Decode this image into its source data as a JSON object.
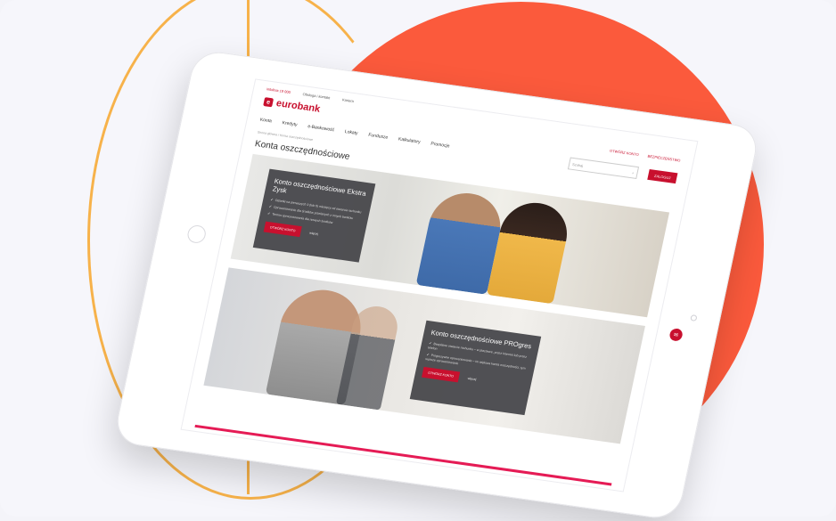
{
  "site": {
    "phone": "infolinia 19 000",
    "top_links": [
      "Obsługa i kontakt",
      "Kariera"
    ],
    "logo_text": "eurobank",
    "utility_links": [
      "OTWÓRZ KONTO",
      "BEZPIECZEŃSTWO"
    ]
  },
  "nav": {
    "items": [
      "Konta",
      "Kredyty",
      "e-Bankowość",
      "Lokaty",
      "Fundusze",
      "Kalkulatory",
      "Promocje"
    ],
    "search_placeholder": "Szukaj",
    "login_label": "ZALOGUJ"
  },
  "breadcrumb": "Strona główna / Konta oszczędnościowe",
  "page_title": "Konta oszczędnościowe",
  "promo1": {
    "title": "Konto oszczędnościowe Ekstra Zysk",
    "bullets": [
      "Odsetki na pierwszych 3 (lub 6) miesięcy od otwarcia rachunku",
      "Oprocentowanie dla środków przelanych z innych banków",
      "Termin oprocentowania dla nowych środków"
    ],
    "cta": "OTWÓRZ KONTO",
    "more": "więcej"
  },
  "promo2": {
    "title": "Konto oszczędnościowe PROgres",
    "bullets": [
      "Bezpłatne otwarcie rachunku – w placówce, przez Internet lub przez telefon",
      "Progresywne oprocentowanie – im większa kwota oszczędności, tym wyższe oprocentowanie"
    ],
    "cta": "OTWÓRZ KONTO",
    "more": "więcej"
  },
  "colors": {
    "brand": "#c8102e",
    "accent_circle": "#fb5a3c",
    "arc": "#f7b24a"
  }
}
